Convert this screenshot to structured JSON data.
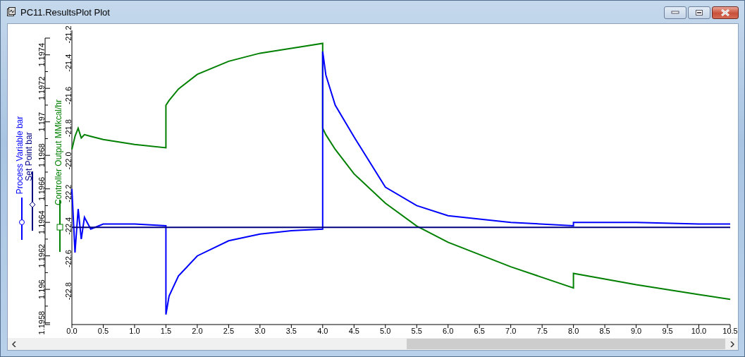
{
  "window": {
    "title": "PC11.ResultsPlot Plot"
  },
  "plot": {
    "legend_markers": [
      {
        "kind": "circle"
      },
      {
        "kind": "diamond"
      },
      {
        "kind": "square"
      }
    ],
    "chart_data": {
      "type": "line",
      "x": [
        0,
        0.05,
        0.1,
        0.15,
        0.2,
        0.3,
        0.5,
        1.0,
        1.5,
        1.5,
        1.55,
        1.7,
        2.0,
        2.5,
        3.0,
        3.5,
        4.0,
        4.0,
        4.05,
        4.2,
        4.5,
        5.0,
        5.5,
        6.0,
        7.0,
        8.0,
        8.0,
        9.0,
        10.0,
        10.5
      ],
      "xlim": [
        0,
        10.5
      ],
      "xticks": [
        {
          "value": 0,
          "label": "0.0"
        },
        {
          "value": 0.5,
          "label": "0.5"
        },
        {
          "value": 1,
          "label": "1.0"
        },
        {
          "value": 1.5,
          "label": "1.5"
        },
        {
          "value": 2,
          "label": "2.0"
        },
        {
          "value": 2.5,
          "label": "2.5"
        },
        {
          "value": 3,
          "label": "3.0"
        },
        {
          "value": 3.5,
          "label": "3.5"
        },
        {
          "value": 4,
          "label": "4.0"
        },
        {
          "value": 4.5,
          "label": "4.5"
        },
        {
          "value": 5,
          "label": "5.0"
        },
        {
          "value": 5.5,
          "label": "5.5"
        },
        {
          "value": 6,
          "label": "6.0"
        },
        {
          "value": 6.5,
          "label": "6.5"
        },
        {
          "value": 7,
          "label": "7.0"
        },
        {
          "value": 7.5,
          "label": "7.5"
        },
        {
          "value": 8,
          "label": "8.0"
        },
        {
          "value": 8.5,
          "label": "8.5"
        },
        {
          "value": 9,
          "label": "9.0"
        },
        {
          "value": 9.5,
          "label": "9.5"
        },
        {
          "value": 10,
          "label": "10.0"
        },
        {
          "value": 10.5,
          "label": "10.5"
        }
      ],
      "ylim": [
        1.19579,
        1.1975
      ],
      "yticks": [
        {
          "value": 1.1958,
          "label": "1.1958"
        },
        {
          "value": 1.196,
          "label": "1.196"
        },
        {
          "value": 1.1962,
          "label": "1.1962"
        },
        {
          "value": 1.1964,
          "label": "1.1964"
        },
        {
          "value": 1.1966,
          "label": "1.1966"
        },
        {
          "value": 1.1968,
          "label": "1.1968"
        },
        {
          "value": 1.197,
          "label": "1.197"
        },
        {
          "value": 1.1972,
          "label": "1.1972"
        },
        {
          "value": 1.1974,
          "label": "1.1974"
        }
      ],
      "y2lim": [
        -23.0,
        -21.2
      ],
      "y2ticks": [
        {
          "value": -22.8,
          "label": "-22.8"
        },
        {
          "value": -22.6,
          "label": "-22.6"
        },
        {
          "value": -22.4,
          "label": "-22.4"
        },
        {
          "value": -22.2,
          "label": "-22.2"
        },
        {
          "value": -22.0,
          "label": "-22.0"
        },
        {
          "value": -21.8,
          "label": "-21.8"
        },
        {
          "value": -21.6,
          "label": "-21.6"
        },
        {
          "value": -21.4,
          "label": "-21.4"
        },
        {
          "value": -21.2,
          "label": "-21.2"
        }
      ],
      "series": [
        {
          "name": "Process Variable bar",
          "color": "#0000ff",
          "values": [
            1.1966,
            1.19622,
            1.19648,
            1.1963,
            1.19643,
            1.19636,
            1.19639,
            1.19639,
            1.19638,
            1.19585,
            1.19596,
            1.19608,
            1.1962,
            1.19629,
            1.19633,
            1.19635,
            1.19636,
            1.19742,
            1.19728,
            1.1971,
            1.19691,
            1.19661,
            1.1965,
            1.19644,
            1.1964,
            1.19638,
            1.1964,
            1.1964,
            1.19639,
            1.19639
          ]
        },
        {
          "name": "Set Point bar",
          "color": "#000080",
          "values": [
            1.19637,
            1.19637,
            1.19637,
            1.19637,
            1.19637,
            1.19637,
            1.19637,
            1.19637,
            1.19637,
            1.19637,
            1.19637,
            1.19637,
            1.19637,
            1.19637,
            1.19637,
            1.19637,
            1.19637,
            1.19637,
            1.19637,
            1.19637,
            1.19637,
            1.19637,
            1.19637,
            1.19637,
            1.19637,
            1.19637,
            1.19637,
            1.19637,
            1.19637,
            1.19637
          ]
        },
        {
          "name": "Controller Output MMkcal/hr",
          "color": "#008000",
          "axis": "y2",
          "values": [
            -21.93,
            -21.85,
            -21.8,
            -21.86,
            -21.84,
            -21.85,
            -21.87,
            -21.9,
            -21.92,
            -21.66,
            -21.63,
            -21.56,
            -21.47,
            -21.39,
            -21.34,
            -21.31,
            -21.28,
            -21.8,
            -21.84,
            -21.93,
            -22.08,
            -22.26,
            -22.4,
            -22.5,
            -22.65,
            -22.78,
            -22.69,
            -22.76,
            -22.82,
            -22.85
          ]
        }
      ]
    }
  }
}
